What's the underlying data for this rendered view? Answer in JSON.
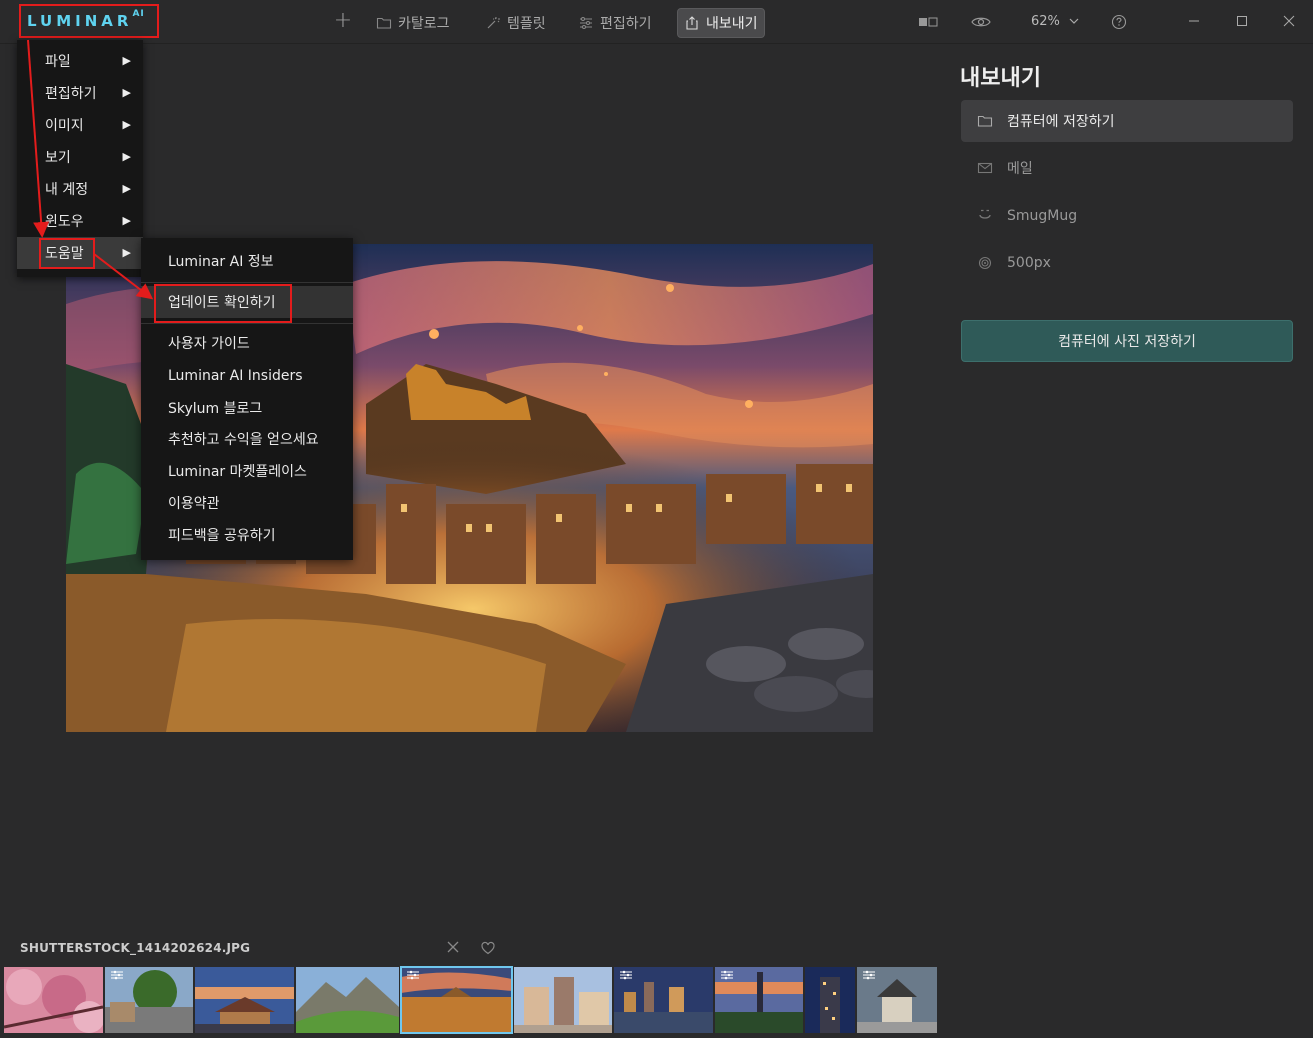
{
  "app": {
    "logo_text": "LUMINAR",
    "logo_sup": "AI",
    "accent": "#5fd3f0",
    "highlight_red": "#e31c1c"
  },
  "toolbar": {
    "add_icon": "plus-icon",
    "nav": [
      {
        "label": "카탈로그",
        "icon": "folder-icon",
        "active": false
      },
      {
        "label": "템플릿",
        "icon": "magic-wand-icon",
        "active": false
      },
      {
        "label": "편집하기",
        "icon": "sliders-icon",
        "active": false
      },
      {
        "label": "내보내기",
        "icon": "share-icon",
        "active": true
      }
    ],
    "zoom_value": "62%"
  },
  "main_menu": {
    "items": [
      {
        "label": "파일"
      },
      {
        "label": "편집하기"
      },
      {
        "label": "이미지"
      },
      {
        "label": "보기"
      },
      {
        "label": "내 계정"
      },
      {
        "label": "윈도우"
      },
      {
        "label": "도움말",
        "highlighted": true
      }
    ],
    "arrow_glyph": "▶"
  },
  "help_submenu": {
    "items": [
      {
        "label": "Luminar AI 정보"
      },
      {
        "label": "업데이트 확인하기",
        "highlighted": true
      },
      {
        "label": "사용자 가이드"
      },
      {
        "label": "Luminar AI Insiders"
      },
      {
        "label": "Skylum 블로그"
      },
      {
        "label": "추천하고 수익을 얻으세요"
      },
      {
        "label": "Luminar 마켓플레이스"
      },
      {
        "label": "이용약관"
      },
      {
        "label": "피드백을 공유하기"
      }
    ]
  },
  "export_panel": {
    "title": "내보내기",
    "options": [
      {
        "label": "컴퓨터에 저장하기",
        "icon": "folder-icon",
        "selected": true
      },
      {
        "label": "메일",
        "icon": "mail-icon",
        "selected": false
      },
      {
        "label": "SmugMug",
        "icon": "smugmug-icon",
        "selected": false
      },
      {
        "label": "500px",
        "icon": "500px-icon",
        "selected": false
      }
    ],
    "save_button": "컴퓨터에 사진 저장하기"
  },
  "filmstrip": {
    "filename": "SHUTTERSTOCK_1414202624.JPG",
    "thumbnails": [
      {
        "subject": "cherry blossoms",
        "edited": false,
        "selected": false
      },
      {
        "subject": "street with trees",
        "edited": true,
        "selected": false
      },
      {
        "subject": "palace at dusk",
        "edited": false,
        "selected": false
      },
      {
        "subject": "mountain landscape",
        "edited": false,
        "selected": false
      },
      {
        "subject": "old town at night",
        "edited": true,
        "selected": true
      },
      {
        "subject": "european square",
        "edited": false,
        "selected": false
      },
      {
        "subject": "city river at night",
        "edited": true,
        "selected": false
      },
      {
        "subject": "tower skyline",
        "edited": true,
        "selected": false
      },
      {
        "subject": "skyscraper at dusk",
        "edited": false,
        "selected": false
      },
      {
        "subject": "temple building",
        "edited": true,
        "selected": false
      }
    ]
  }
}
